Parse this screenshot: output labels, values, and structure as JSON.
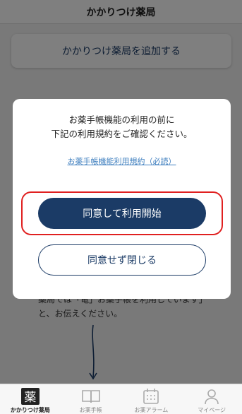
{
  "header": {
    "title": "かかりつけ薬局"
  },
  "main": {
    "add_pharmacy_label": "かかりつけ薬局を追加する",
    "background_text_line1": "薬局では「竜」お薬手帳を利用しています」",
    "background_text_line2": "と、お伝えください。"
  },
  "modal": {
    "message_line1": "お薬手帳機能の利用の前に",
    "message_line2": "下記の利用規約をご確認ください。",
    "terms_link": "お薬手帳機能利用規約（必読）",
    "agree_label": "同意して利用開始",
    "decline_label": "同意せず閉じる",
    "highlight_color": "#e02020",
    "primary_color": "#1b3b66"
  },
  "tabbar": {
    "items": [
      {
        "label": "かかりつけ薬局",
        "icon": "pharmacy-kanji-icon",
        "glyph": "薬",
        "active": true
      },
      {
        "label": "お薬手帳",
        "icon": "book-icon",
        "active": false
      },
      {
        "label": "お薬アラーム",
        "icon": "calendar-icon",
        "active": false
      },
      {
        "label": "マイページ",
        "icon": "user-icon",
        "active": false
      }
    ]
  }
}
